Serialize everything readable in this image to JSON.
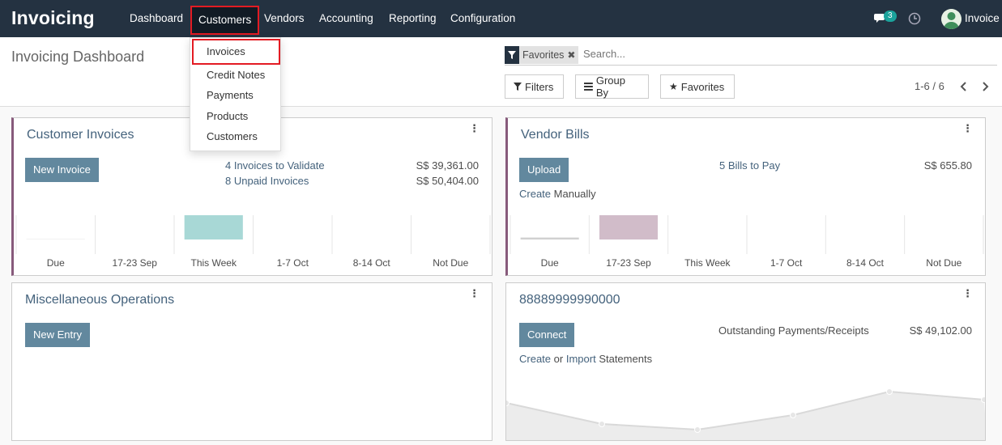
{
  "navbar": {
    "brand": "Invoicing",
    "menu": [
      "Dashboard",
      "Customers",
      "Vendors",
      "Accounting",
      "Reporting",
      "Configuration"
    ],
    "active_menu": "Customers",
    "notification_count": "3",
    "user_name": "Invoice"
  },
  "dropdown": {
    "items": [
      "Invoices",
      "Credit Notes",
      "Payments",
      "Products",
      "Customers"
    ],
    "highlighted": "Invoices"
  },
  "control_panel": {
    "title": "Invoicing Dashboard",
    "facet_label": "Favorites",
    "search_placeholder": "Search...",
    "filters_label": "Filters",
    "groupby_label": "Group By",
    "favorites_label": "Favorites",
    "pager": "1-6 / 6"
  },
  "cards": {
    "customer_invoices": {
      "title": "Customer Invoices",
      "button": "New Invoice",
      "rows": [
        {
          "label": "4 Invoices to Validate",
          "amount": "S$ 39,361.00"
        },
        {
          "label": "8 Unpaid Invoices",
          "amount": "S$ 50,404.00"
        }
      ],
      "chart_labels": [
        "Due",
        "17-23 Sep",
        "This Week",
        "1-7 Oct",
        "8-14 Oct",
        "Not Due"
      ],
      "chart_values": [
        0.03,
        0,
        1,
        0,
        0,
        0
      ],
      "bar_color": "#a8d8d6"
    },
    "vendor_bills": {
      "title": "Vendor Bills",
      "button": "Upload",
      "rows": [
        {
          "label": "5 Bills to Pay",
          "amount": "S$ 655.80"
        }
      ],
      "create_link": "Create",
      "create_suffix": "Manually",
      "chart_labels": [
        "Due",
        "17-23 Sep",
        "This Week",
        "1-7 Oct",
        "8-14 Oct",
        "Not Due"
      ],
      "chart_values": [
        0.08,
        1,
        0,
        0,
        0,
        0
      ],
      "bar_colors": [
        "#d0d0d0",
        "#d1bcc9"
      ]
    },
    "misc_operations": {
      "title": "Miscellaneous Operations",
      "button": "New Entry"
    },
    "bank": {
      "title": "88889999990000",
      "button": "Connect",
      "row_label": "Outstanding Payments/Receipts",
      "row_amount": "S$ 49,102.00",
      "create_link": "Create",
      "or_text": "or",
      "import_link": "Import",
      "statements_text": "Statements",
      "line_values": [
        0.98,
        0.73,
        0.63,
        0.71,
        0.92,
        0.85
      ]
    }
  },
  "colors": {
    "navbar": "#243241",
    "accent": "#875a7b",
    "primary_button": "#62889e",
    "link": "#44627c",
    "highlight_border": "#e31b23"
  }
}
